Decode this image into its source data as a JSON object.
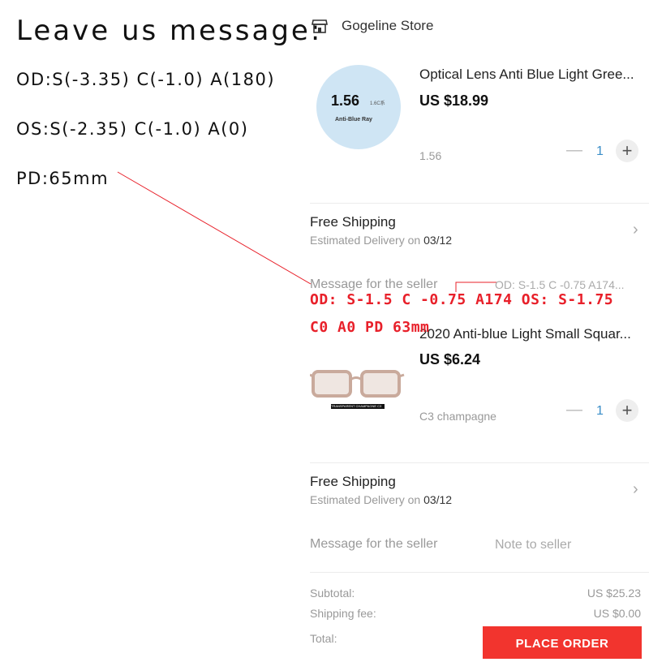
{
  "instructions": {
    "title": "Leave us message:",
    "od": "OD:S(-3.35) C(-1.0) A(180)",
    "os": "OS:S(-2.35) C(-1.0) A(0)",
    "pd": "PD:65mm"
  },
  "store": {
    "name": "Gogeline Store",
    "icon": "store-icon"
  },
  "items": [
    {
      "title": "Optical Lens Anti Blue Light Gree...",
      "price": "US $18.99",
      "variant": "1.56",
      "qty": "1",
      "image": {
        "value": "1.56",
        "mini": "1.6C系",
        "sub": "Anti-Blue Ray",
        "color": "#cfe5f4"
      }
    },
    {
      "title": "2020 Anti-blue Light Small Squar...",
      "price": "US $6.24",
      "variant": "C3 champagne",
      "qty": "1",
      "image": {
        "caption": "TRANSPARENT CHAMPAGNE C3",
        "frame_color": "#c9aa9c"
      }
    }
  ],
  "shipping": [
    {
      "title": "Free Shipping",
      "estimate_prefix": "Estimated Delivery on",
      "date": "03/12"
    },
    {
      "title": "Free Shipping",
      "estimate_prefix": "Estimated Delivery on",
      "date": "03/12"
    }
  ],
  "messages": [
    {
      "label": "Message for the seller",
      "value": "OD: S-1.5 C -0.75 A174..."
    },
    {
      "label": "Message for the seller",
      "placeholder": "Note to seller"
    }
  ],
  "red_note": {
    "line1": "OD: S-1.5 C -0.75 A174 OS: S-1.75",
    "line2": "C0 A0 PD 63mm"
  },
  "summary": {
    "subtotal_label": "Subtotal:",
    "subtotal_value": "US $25.23",
    "shipping_label": "Shipping fee:",
    "shipping_value": "US $0.00",
    "total_label": "Total:"
  },
  "place_order_label": "PLACE ORDER",
  "colors": {
    "accent_red": "#f2342e",
    "annotation_red": "#e8202a",
    "qty_blue": "#3a8ec8"
  }
}
